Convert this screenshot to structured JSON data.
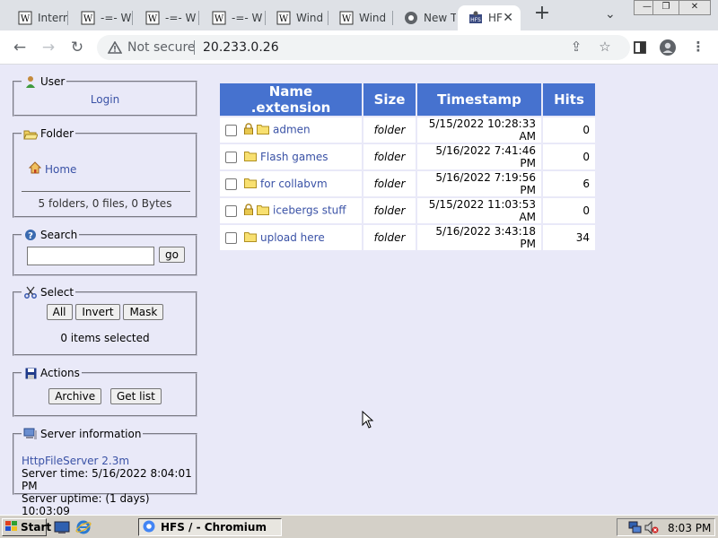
{
  "browser": {
    "tabs": [
      {
        "label": "Intern",
        "icon": "wiki-icon"
      },
      {
        "label": "-=- W",
        "icon": "wiki-icon"
      },
      {
        "label": "-=- W",
        "icon": "wiki-icon"
      },
      {
        "label": "-=- W",
        "icon": "wiki-icon"
      },
      {
        "label": "Wind",
        "icon": "wiki-icon"
      },
      {
        "label": "Wind",
        "icon": "wiki-icon"
      },
      {
        "label": "New T",
        "icon": "chrome-icon"
      },
      {
        "label": "HF",
        "icon": "hfs-icon",
        "active": true
      }
    ],
    "address": {
      "security_label": "Not secure",
      "url": "20.233.0.26"
    }
  },
  "sidebar": {
    "user": {
      "legend": "User",
      "login_label": "Login"
    },
    "folder": {
      "legend": "Folder",
      "home_label": "Home",
      "summary": "5 folders, 0 files, 0 Bytes"
    },
    "search": {
      "legend": "Search",
      "value": "",
      "go_label": "go"
    },
    "select": {
      "legend": "Select",
      "all_label": "All",
      "invert_label": "Invert",
      "mask_label": "Mask",
      "status": "0 items selected"
    },
    "actions": {
      "legend": "Actions",
      "archive_label": "Archive",
      "getlist_label": "Get list"
    },
    "server": {
      "legend": "Server information",
      "version": "HttpFileServer 2.3m",
      "time": "Server time: 5/16/2022 8:04:01 PM",
      "uptime": "Server uptime: (1 days) 10:03:09"
    }
  },
  "files": {
    "headers": {
      "name": "Name .extension",
      "size": "Size",
      "timestamp": "Timestamp",
      "hits": "Hits"
    },
    "rows": [
      {
        "name": "admen",
        "locked": true,
        "size": "folder",
        "timestamp": "5/15/2022 10:28:33 AM",
        "hits": "0"
      },
      {
        "name": "Flash games",
        "locked": false,
        "size": "folder",
        "timestamp": "5/16/2022 7:41:46 PM",
        "hits": "0"
      },
      {
        "name": "for collabvm",
        "locked": false,
        "size": "folder",
        "timestamp": "5/16/2022 7:19:56 PM",
        "hits": "6"
      },
      {
        "name": "icebergs stuff",
        "locked": true,
        "size": "folder",
        "timestamp": "5/15/2022 11:03:53 AM",
        "hits": "0"
      },
      {
        "name": "upload here",
        "locked": false,
        "size": "folder",
        "timestamp": "5/16/2022 3:43:18 PM",
        "hits": "34"
      }
    ]
  },
  "taskbar": {
    "start_label": "Start",
    "task_label": "HFS / - Chromium",
    "clock": "8:03 PM"
  },
  "colors": {
    "header_blue": "#4672cf",
    "link_blue": "#3a52a6",
    "page_bg": "#e9e9f8"
  }
}
